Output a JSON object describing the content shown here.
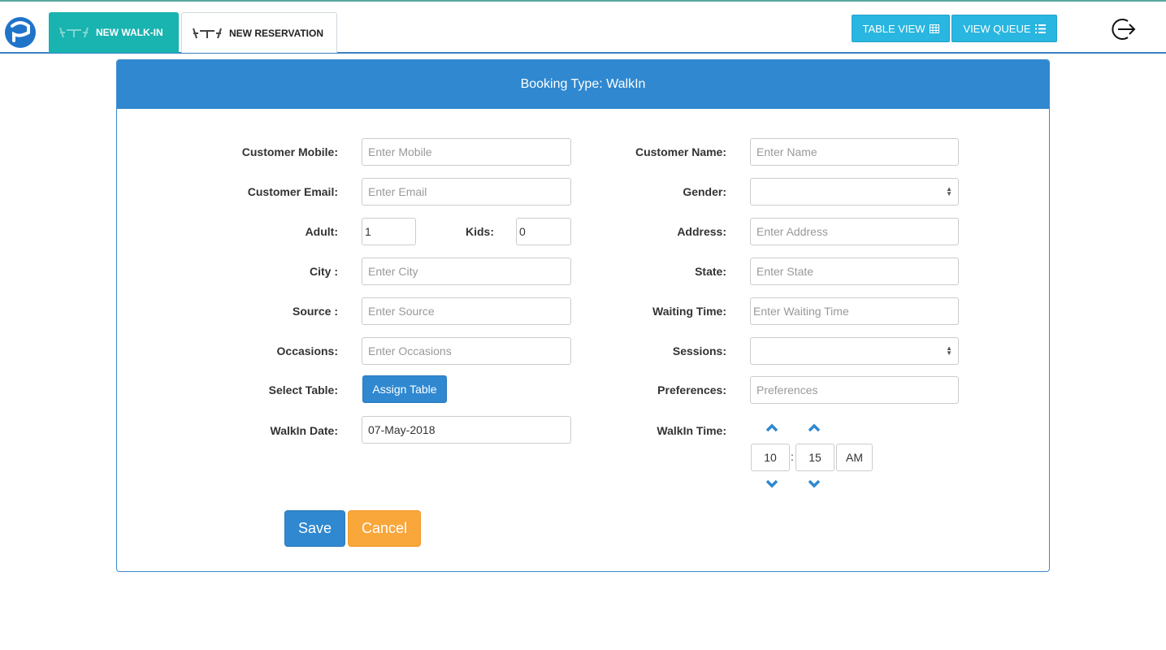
{
  "header": {
    "tabs": [
      {
        "label": "NEW WALK-IN",
        "active": true
      },
      {
        "label": "NEW RESERVATION",
        "active": false
      }
    ],
    "table_view_label": "TABLE VIEW",
    "view_queue_label": "VIEW QUEUE",
    "icons": {
      "logo": "app-logo-icon",
      "table": "grid-icon",
      "queue": "list-icon",
      "logout": "logout-icon"
    }
  },
  "form": {
    "title": "Booking Type: WalkIn",
    "labels": {
      "customer_mobile": "Customer Mobile:",
      "customer_name": "Customer Name:",
      "customer_email": "Customer Email:",
      "gender": "Gender:",
      "adult": "Adult:",
      "kids": "Kids:",
      "address": "Address:",
      "city": "City :",
      "state": "State:",
      "source": "Source :",
      "waiting_time": "Waiting Time:",
      "occasions": "Occasions:",
      "sessions": "Sessions:",
      "select_table": "Select Table:",
      "preferences": "Preferences:",
      "walkin_date": "WalkIn Date:",
      "walkin_time": "WalkIn Time:"
    },
    "placeholders": {
      "customer_mobile": "Enter Mobile",
      "customer_name": "Enter Name",
      "customer_email": "Enter Email",
      "address": "Enter Address",
      "city": "Enter City",
      "state": "Enter State",
      "source": "Enter Source",
      "waiting_time": "Enter Waiting Time",
      "occasions": "Enter Occasions",
      "preferences": "Preferences"
    },
    "values": {
      "adult": "1",
      "kids": "0",
      "walkin_date": "07-May-2018",
      "gender": "",
      "sessions": ""
    },
    "assign_table_label": "Assign Table",
    "time": {
      "hour": "10",
      "separator": ":",
      "minute": "15",
      "meridian": "AM"
    },
    "save_label": "Save",
    "cancel_label": "Cancel"
  },
  "colors": {
    "primary": "#2f88d0",
    "teal": "#19b3b0",
    "info": "#29b6e0",
    "warning": "#f9a63a"
  }
}
